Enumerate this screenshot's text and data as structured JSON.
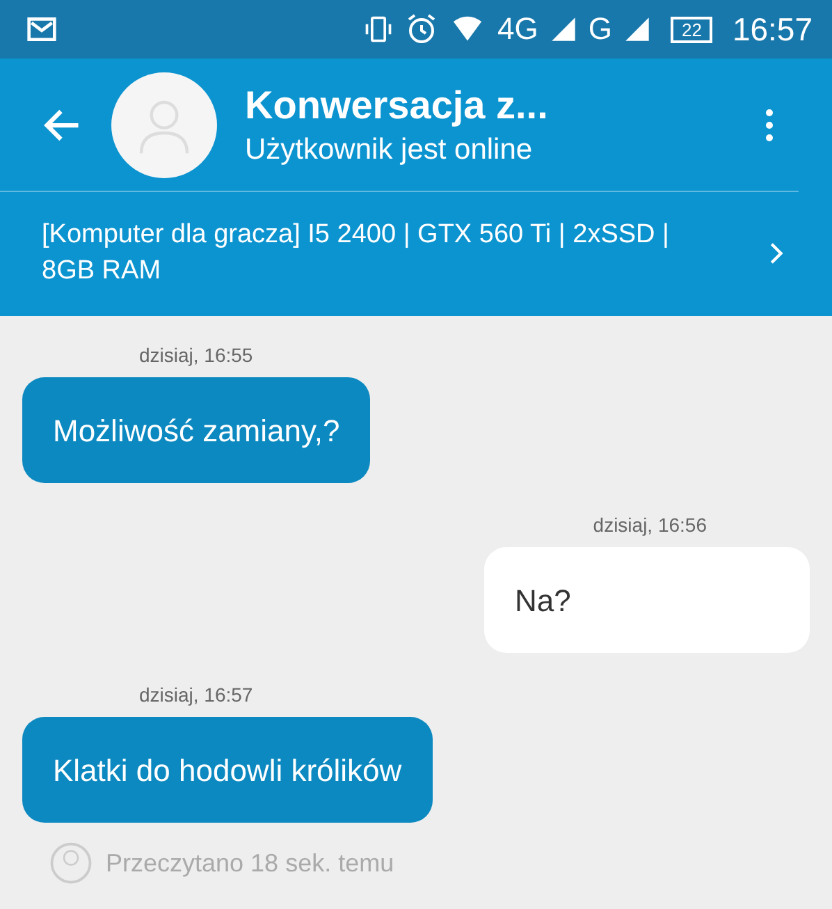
{
  "status_bar": {
    "network_4g": "4G",
    "network_g": "G",
    "battery": "22",
    "time": "16:57"
  },
  "header": {
    "title": "Konwersacja z...",
    "subtitle": "Użytkownik jest online",
    "listing": "[Komputer dla gracza] I5 2400 | GTX 560 Ti | 2xSSD | 8GB RAM"
  },
  "messages": [
    {
      "kind": "incoming",
      "time": "dzisiaj, 16:55",
      "text": "Możliwość zamiany,?"
    },
    {
      "kind": "outgoing",
      "time": "dzisiaj, 16:56",
      "text": "Na?"
    },
    {
      "kind": "incoming",
      "time": "dzisiaj, 16:57",
      "text": "Klatki do hodowli królików"
    }
  ],
  "read_receipt": "Przeczytano 18 sek. temu"
}
